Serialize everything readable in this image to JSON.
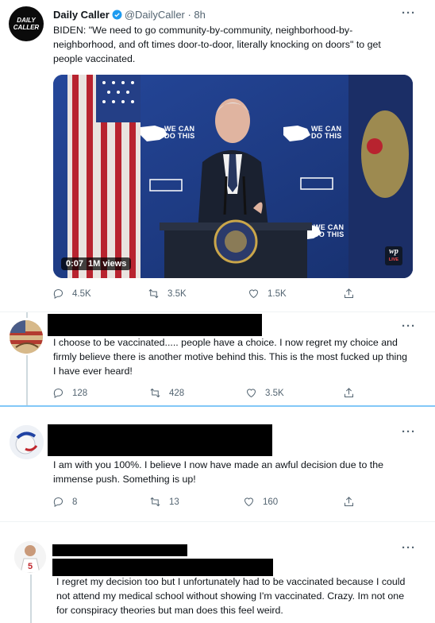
{
  "tweet_main": {
    "author_name": "Daily Caller",
    "handle_time": "@DailyCaller · 8h",
    "avatar_text": [
      "DAILY",
      "CALLER"
    ],
    "more": "···",
    "text": "BIDEN: \"We need to go community-by-community, neighborhood-by-neighborhood, and oft times door-to-door, literally knocking on doors\" to get people vaccinated.",
    "video": {
      "duration": "0:07",
      "views": "1M views",
      "banner_text": "WE CAN DO THIS",
      "live_label": "LIVE",
      "wp_logo": "wp"
    },
    "replies": "4.5K",
    "retweets": "3.5K",
    "likes": "1.5K"
  },
  "reply_1": {
    "more": "···",
    "text": "I choose to be vaccinated..... people have a choice. I now regret my choice and firmly believe there is another motive behind this. This is the most fucked up thing I have ever heard!",
    "replies": "128",
    "retweets": "428",
    "likes": "3.5K"
  },
  "reply_2": {
    "more": "···",
    "text": "I am with you 100%. I believe I now have made an awful decision due to the immense push. Something is up!",
    "replies": "8",
    "retweets": "13",
    "likes": "160"
  },
  "reply_3": {
    "more": "···",
    "text": "I regret my decision too but I unfortunately had to be vaccinated because I could not attend my medical school without showing I'm vaccinated. Crazy. Im not one for conspiracy theories but man does this feel weird."
  },
  "colors": {
    "accent": "#1d9bf0",
    "text_primary": "#0f1419",
    "text_secondary": "#536471"
  },
  "icons": [
    "reply-icon",
    "retweet-icon",
    "like-icon",
    "share-icon",
    "verified-badge-icon",
    "more-icon"
  ]
}
